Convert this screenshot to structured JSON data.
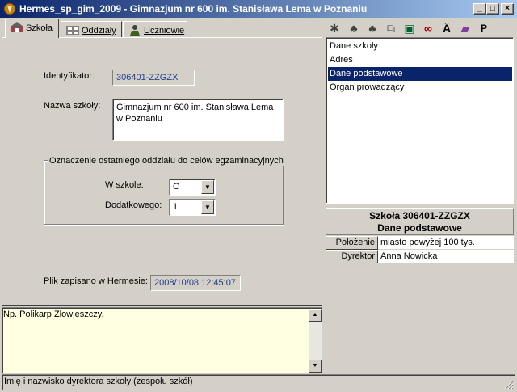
{
  "window": {
    "title": "Hermes_sp_gim_2009 - Gimnazjum nr 600 im. Stanisława Lema w Poznaniu",
    "controls": {
      "minimize": "_",
      "maximize": "□",
      "close": "×"
    }
  },
  "tabs": [
    {
      "label": "Szkoła",
      "icon": "school-icon",
      "active": true
    },
    {
      "label": "Oddziały",
      "icon": "classes-icon",
      "active": false
    },
    {
      "label": "Uczniowie",
      "icon": "students-icon",
      "active": false
    }
  ],
  "school_tab": {
    "identifier_label": "Identyfikator:",
    "identifier_value": "306401-ZZGZX",
    "name_label": "Nazwa szkoły:",
    "name_value": "Gimnazjum nr 600 im. Stanisława Lema w Poznaniu",
    "group_title": "Oznaczenie ostatniego oddziału do celów egzaminacyjnych",
    "in_school_label": "W szkole:",
    "in_school_value": "C",
    "additional_label": "Dodatkowego:",
    "additional_value": "1",
    "saved_label": "Plik zapisano w Hermesie:",
    "saved_value": "2008/10/08 12:45:07"
  },
  "toolbar": {
    "buttons": [
      {
        "name": "add-person-icon",
        "glyph": "✱"
      },
      {
        "name": "person-icon",
        "glyph": "♣"
      },
      {
        "name": "persons-icon",
        "glyph": "♣"
      },
      {
        "name": "copy-icon",
        "glyph": "⧉"
      },
      {
        "name": "save-icon",
        "glyph": "▣"
      },
      {
        "name": "binoculars-icon",
        "glyph": "∞"
      },
      {
        "name": "a-umlaut-icon",
        "glyph": "Ä"
      },
      {
        "name": "book-icon",
        "glyph": "▰"
      },
      {
        "name": "p-letter-icon",
        "glyph": "P"
      }
    ]
  },
  "menu_list": {
    "items": [
      "Dane szkoły",
      "Adres",
      "Dane podstawowe",
      "Organ prowadzący"
    ],
    "selected_index": 2
  },
  "info_panel": {
    "title": "Szkoła 306401-ZZGZX",
    "subtitle": "Dane podstawowe",
    "rows": [
      {
        "label": "Położenie",
        "value": "miasto powyżej 100 tys."
      },
      {
        "label": "Dyrektor",
        "value": "Anna Nowicka"
      }
    ]
  },
  "memo": {
    "text": "Np. Polikarp Złowieszczy.",
    "scroll_up": "▲",
    "scroll_down": "▼"
  },
  "status_bar": {
    "text": "Imię i nazwisko dyrektora szkoły (zespołu szkół)"
  },
  "colors": {
    "title_bar_start": "#0a246a",
    "title_bar_end": "#a6caf0",
    "selection": "#0a246a",
    "window_face": "#d4d0c8",
    "memo_background": "#ffffe1",
    "readonly_text": "#1f3f8f"
  }
}
